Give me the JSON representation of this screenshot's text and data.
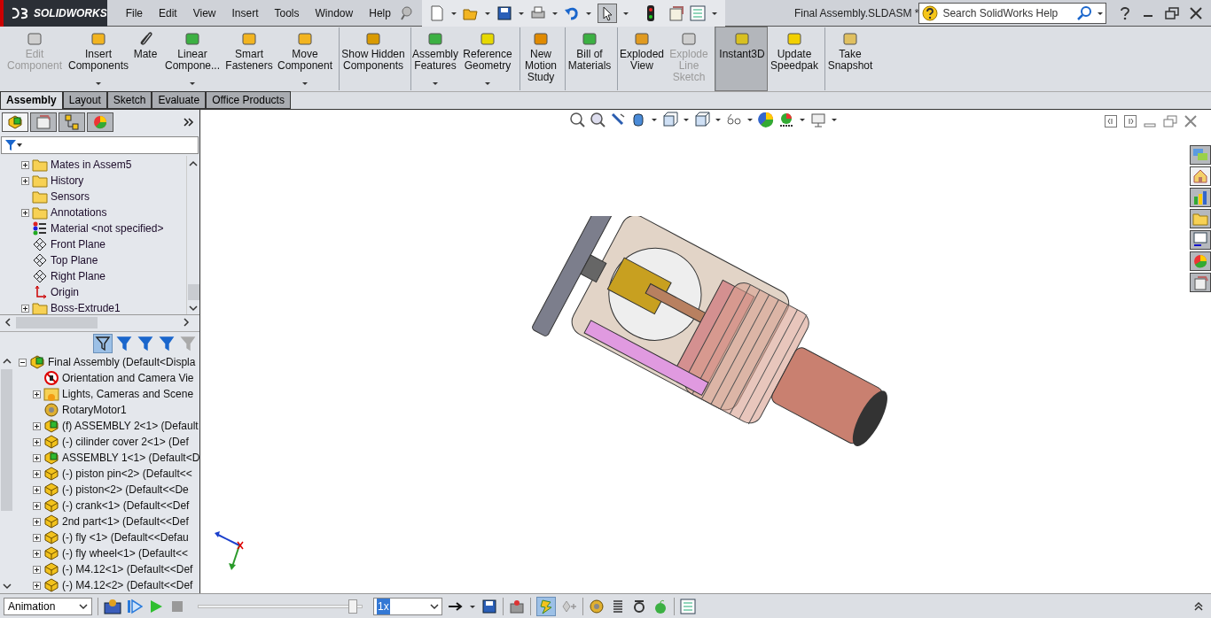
{
  "title_bar": {
    "logo": "SOLIDWORKS",
    "menus": [
      "File",
      "Edit",
      "View",
      "Insert",
      "Tools",
      "Window",
      "Help"
    ],
    "document_title": "Final Assembly.SLDASM *",
    "search": {
      "placeholder": "Search SolidWorks Help"
    }
  },
  "command_manager": [
    {
      "label": "Edit Component",
      "disabled": true,
      "selected": false,
      "dropdown": false,
      "group_start": false
    },
    {
      "label": "Insert Components",
      "disabled": false,
      "selected": false,
      "dropdown": true,
      "group_start": false
    },
    {
      "label": "Mate",
      "disabled": false,
      "selected": false,
      "dropdown": false,
      "group_start": false
    },
    {
      "label": "Linear Compone...",
      "disabled": false,
      "selected": false,
      "dropdown": true,
      "group_start": false
    },
    {
      "label": "Smart Fasteners",
      "disabled": false,
      "selected": false,
      "dropdown": false,
      "group_start": false
    },
    {
      "label": "Move Component",
      "disabled": false,
      "selected": false,
      "dropdown": true,
      "group_start": false
    },
    {
      "label": "Show Hidden Components",
      "disabled": false,
      "selected": false,
      "dropdown": false,
      "group_start": true
    },
    {
      "label": "Assembly Features",
      "disabled": false,
      "selected": false,
      "dropdown": true,
      "group_start": true
    },
    {
      "label": "Reference Geometry",
      "disabled": false,
      "selected": false,
      "dropdown": true,
      "group_start": false
    },
    {
      "label": "New Motion Study",
      "disabled": false,
      "selected": false,
      "dropdown": false,
      "group_start": true
    },
    {
      "label": "Bill of Materials",
      "disabled": false,
      "selected": false,
      "dropdown": false,
      "group_start": true
    },
    {
      "label": "Exploded View",
      "disabled": false,
      "selected": false,
      "dropdown": false,
      "group_start": true
    },
    {
      "label": "Explode Line Sketch",
      "disabled": true,
      "selected": false,
      "dropdown": false,
      "group_start": false
    },
    {
      "label": "Instant3D",
      "disabled": false,
      "selected": true,
      "dropdown": false,
      "group_start": true
    },
    {
      "label": "Update Speedpak",
      "disabled": false,
      "selected": false,
      "dropdown": false,
      "group_start": false
    },
    {
      "label": "Take Snapshot",
      "disabled": false,
      "selected": false,
      "dropdown": false,
      "group_start": true
    }
  ],
  "tabs": [
    {
      "label": "Assembly",
      "selected": true
    },
    {
      "label": "Layout",
      "selected": false
    },
    {
      "label": "Sketch",
      "selected": false
    },
    {
      "label": "Evaluate",
      "selected": false
    },
    {
      "label": "Office Products",
      "selected": false
    }
  ],
  "feature_tree": [
    {
      "label": "Mates in Assem5",
      "expandable": true
    },
    {
      "label": "History",
      "expandable": true
    },
    {
      "label": "Sensors",
      "expandable": false
    },
    {
      "label": "Annotations",
      "expandable": true
    },
    {
      "label": "Material <not specified>",
      "expandable": false
    },
    {
      "label": "Front Plane",
      "expandable": false
    },
    {
      "label": "Top Plane",
      "expandable": false
    },
    {
      "label": "Right Plane",
      "expandable": false
    },
    {
      "label": "Origin",
      "expandable": false
    },
    {
      "label": "Boss-Extrude1",
      "expandable": true
    }
  ],
  "motion_tree": {
    "label": "Final Assembly  (Default<Displa",
    "expanded": true,
    "children": [
      {
        "label": "Orientation and Camera Vie",
        "expandable": false
      },
      {
        "label": "Lights, Cameras and Scene",
        "expandable": true
      },
      {
        "label": "RotaryMotor1",
        "expandable": false
      },
      {
        "label": "(f) ASSEMBLY 2<1>  (Default",
        "expandable": true
      },
      {
        "label": "(-) cilinder cover 2<1>  (Def",
        "expandable": true
      },
      {
        "label": "ASSEMBLY 1<1>  (Default<D",
        "expandable": true
      },
      {
        "label": "(-) piston pin<2>  (Default<<",
        "expandable": true
      },
      {
        "label": "(-) piston<2>  (Default<<De",
        "expandable": true
      },
      {
        "label": "(-) crank<1>  (Default<<Def",
        "expandable": true
      },
      {
        "label": "2nd part<1>  (Default<<Def",
        "expandable": true
      },
      {
        "label": "(-) fly <1>  (Default<<Defau",
        "expandable": true
      },
      {
        "label": "(-) fly wheel<1>  (Default<<",
        "expandable": true
      },
      {
        "label": "(-) M4.12<1>  (Default<<Def",
        "expandable": true
      },
      {
        "label": "(-) M4.12<2>  (Default<<Def",
        "expandable": true
      }
    ]
  },
  "motion_manager": {
    "study_type": "Animation",
    "timeline": {
      "level": 0.97
    },
    "speed": "1x"
  }
}
